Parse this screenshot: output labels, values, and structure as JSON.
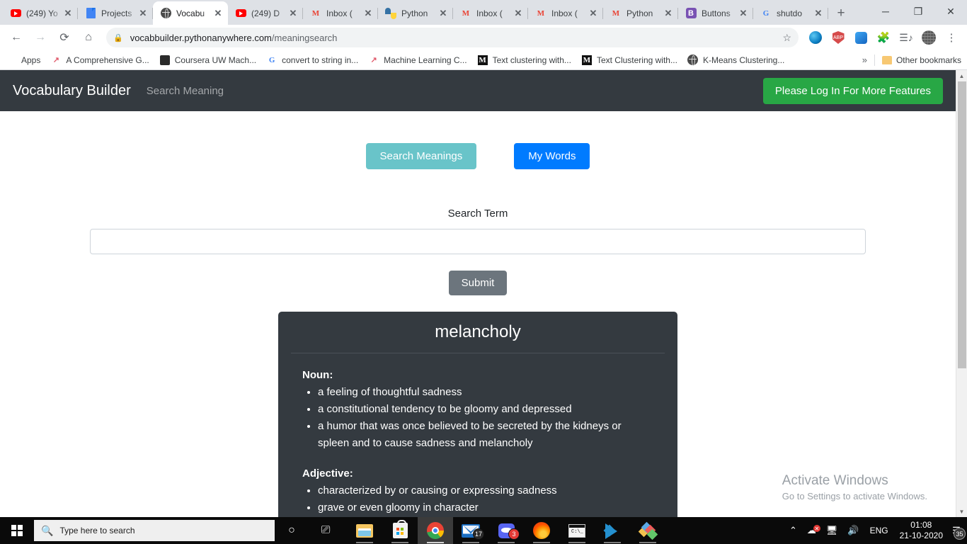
{
  "browser": {
    "tabs": [
      {
        "title": "(249) Yo",
        "icon": "youtube-icon",
        "active": false
      },
      {
        "title": "Projects",
        "icon": "document-icon",
        "active": false
      },
      {
        "title": "Vocabu",
        "icon": "globe-icon",
        "active": true
      },
      {
        "title": "(249) D",
        "icon": "youtube-icon",
        "active": false
      },
      {
        "title": "Inbox (",
        "icon": "gmail-icon",
        "active": false
      },
      {
        "title": "Inbox (",
        "icon": "gmail-icon",
        "active": false
      },
      {
        "title": "Python",
        "icon": "python-icon",
        "active": false
      },
      {
        "title": "Inbox (",
        "icon": "gmail-icon",
        "active": false
      },
      {
        "title": "Python",
        "icon": "gmail-icon",
        "active": false
      },
      {
        "title": "Buttons",
        "icon": "bootstrap-icon",
        "active": false
      },
      {
        "title": "shutdo",
        "icon": "google-icon",
        "active": false
      }
    ],
    "new_tab_label": "+",
    "window_controls": {
      "minimize": "─",
      "maximize": "❐",
      "close": "✕"
    },
    "toolbar": {
      "back": "←",
      "forward": "→",
      "reload": "⟳",
      "home": "⌂",
      "lock": "🔒",
      "url_host": "vocabbuilder.pythonanywhere.com",
      "url_path": "/meaningsearch",
      "star": "☆",
      "kebab": "⋮"
    },
    "bookmarks": [
      {
        "label": "Apps",
        "icon": "apps-grid-icon"
      },
      {
        "label": "A Comprehensive G...",
        "icon": "chart-icon"
      },
      {
        "label": "Coursera UW Mach...",
        "icon": "coursera-icon"
      },
      {
        "label": "convert to string in...",
        "icon": "google-icon"
      },
      {
        "label": "Machine Learning C...",
        "icon": "chart-icon"
      },
      {
        "label": "Text clustering with...",
        "icon": "medium-icon"
      },
      {
        "label": "Text Clustering with...",
        "icon": "medium-icon"
      },
      {
        "label": "K-Means Clustering...",
        "icon": "globe-icon"
      }
    ],
    "bookmarks_overflow": "»",
    "other_bookmarks": "Other bookmarks"
  },
  "page": {
    "navbar": {
      "brand": "Vocabulary Builder",
      "link": "Search Meaning",
      "login_button": "Please Log In For More Features"
    },
    "actions": {
      "search_meanings": "Search Meanings",
      "my_words": "My Words"
    },
    "form": {
      "label": "Search Term",
      "value": "",
      "placeholder": "",
      "submit": "Submit"
    },
    "result_card": {
      "word": "melancholy",
      "sections": [
        {
          "part_of_speech": "Noun:",
          "definitions": [
            "a feeling of thoughtful sadness",
            "a constitutional tendency to be gloomy and depressed",
            "a humor that was once believed to be secreted by the kidneys or spleen and to cause sadness and melancholy"
          ]
        },
        {
          "part_of_speech": "Adjective:",
          "definitions": [
            "characterized by or causing or expressing sadness",
            "grave or even gloomy in character"
          ]
        }
      ]
    },
    "watermark": {
      "title": "Activate Windows",
      "subtitle": "Go to Settings to activate Windows."
    },
    "colors": {
      "navbar_bg": "#343a40",
      "login_green": "#28a745",
      "teal_button": "#69c4c9",
      "blue_button": "#007bff",
      "submit_gray": "#6c757d",
      "card_bg": "#343a40"
    }
  },
  "taskbar": {
    "start": "windows-logo",
    "search_placeholder": "Type here to search",
    "cortana": "○",
    "taskview": "task-view-icon",
    "apps": [
      {
        "name": "file-explorer",
        "badge": ""
      },
      {
        "name": "microsoft-store",
        "badge": ""
      },
      {
        "name": "google-chrome",
        "badge": "",
        "active": true
      },
      {
        "name": "mail",
        "badge": "17"
      },
      {
        "name": "discord",
        "badge": "3"
      },
      {
        "name": "firefox",
        "badge": ""
      },
      {
        "name": "command-prompt",
        "badge": ""
      },
      {
        "name": "visual-studio-code",
        "badge": ""
      },
      {
        "name": "color-diamonds-app",
        "badge": ""
      }
    ],
    "tray": {
      "overflow": "⌃",
      "cloud": "cloud-icon",
      "network": "network-icon",
      "volume": "🔊",
      "language": "ENG",
      "time": "01:08",
      "date": "21-10-2020",
      "notification_count": "35"
    }
  }
}
